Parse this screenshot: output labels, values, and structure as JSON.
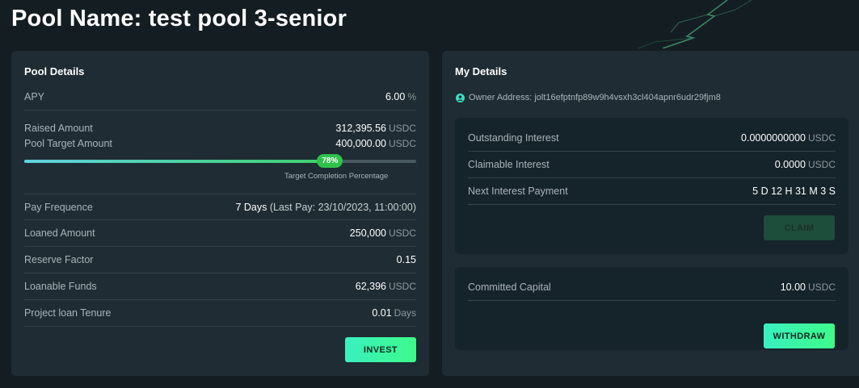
{
  "page": {
    "title": "Pool Name: test pool 3-senior"
  },
  "pool_details": {
    "title": "Pool Details",
    "apy": {
      "label": "APY",
      "value": "6.00",
      "unit": "%"
    },
    "raised": {
      "label": "Raised Amount",
      "value": "312,395.56",
      "unit": "USDC"
    },
    "target": {
      "label": "Pool Target Amount",
      "value": "400,000.00",
      "unit": "USDC"
    },
    "progress": {
      "percent_value": 78,
      "badge": "78%",
      "caption": "Target Completion Percentage"
    },
    "pay_frequence": {
      "label": "Pay Frequence",
      "value": "7 Days",
      "extra": "(Last Pay: 23/10/2023, 11:00:00)"
    },
    "loaned": {
      "label": "Loaned Amount",
      "value": "250,000",
      "unit": "USDC"
    },
    "reserve": {
      "label": "Reserve Factor",
      "value": "0.15"
    },
    "loanable": {
      "label": "Loanable Funds",
      "value": "62,396",
      "unit": "USDC"
    },
    "tenure": {
      "label": "Project loan Tenure",
      "value": "0.01",
      "unit": "Days"
    },
    "invest_label": "INVEST"
  },
  "my_details": {
    "title": "My Details",
    "owner": {
      "label": "Owner Address:",
      "address": "jolt16efptnfp89w9h4vsxh3cl404apnr6udr29fjm8"
    },
    "outstanding": {
      "label": "Outstanding Interest",
      "value": "0.0000000000",
      "unit": "USDC"
    },
    "claimable": {
      "label": "Claimable Interest",
      "value": "0.0000",
      "unit": "USDC"
    },
    "next_payment": {
      "label": "Next Interest Payment",
      "value": "5 D 12 H 31 M 3 S"
    },
    "claim_label": "CLAIM",
    "committed": {
      "label": "Committed Capital",
      "value": "10.00",
      "unit": "USDC"
    },
    "withdraw_label": "WITHDRAW"
  },
  "colors": {
    "accent": "#3af0c0",
    "progress": "#3ed06a",
    "background": "#141e22",
    "panel": "#1f2c33"
  }
}
